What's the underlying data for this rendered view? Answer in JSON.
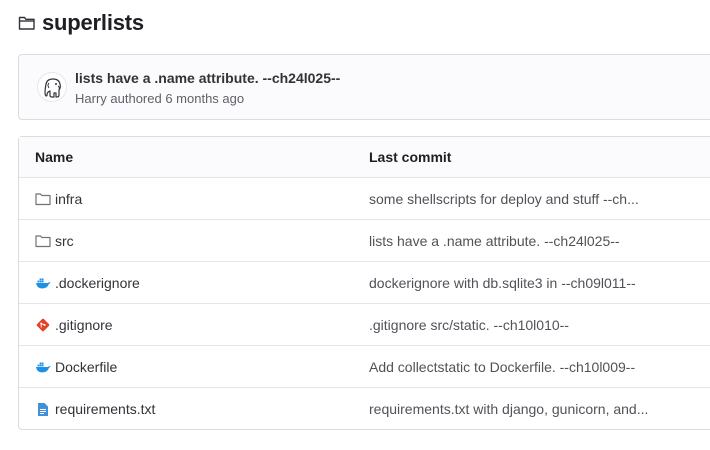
{
  "repo": {
    "title": "superlists",
    "icon": "folder-open-icon"
  },
  "last_commit": {
    "message": "lists have a .name attribute. --ch24l025--",
    "meta": "Harry authored 6 months ago",
    "avatar_icon": "elephant-avatar"
  },
  "table": {
    "headers": {
      "name": "Name",
      "last_commit": "Last commit"
    },
    "rows": [
      {
        "name": "infra",
        "icon": "folder-icon",
        "commit": "some shellscripts for deploy and stuff --ch..."
      },
      {
        "name": "src",
        "icon": "folder-icon",
        "commit": "lists have a .name attribute. --ch24l025--"
      },
      {
        "name": ".dockerignore",
        "icon": "docker-icon",
        "commit": "dockerignore with db.sqlite3 in --ch09l011--"
      },
      {
        "name": ".gitignore",
        "icon": "git-icon",
        "commit": ".gitignore src/static. --ch10l010--"
      },
      {
        "name": "Dockerfile",
        "icon": "docker-icon",
        "commit": "Add collectstatic to Dockerfile. --ch10l009--"
      },
      {
        "name": "requirements.txt",
        "icon": "text-file-icon",
        "commit": "requirements.txt with django, gunicorn, and..."
      }
    ]
  },
  "colors": {
    "docker": "#1d91e6",
    "git": "#e24329",
    "text_file": "#428fdc",
    "folder_stroke": "#737278"
  }
}
